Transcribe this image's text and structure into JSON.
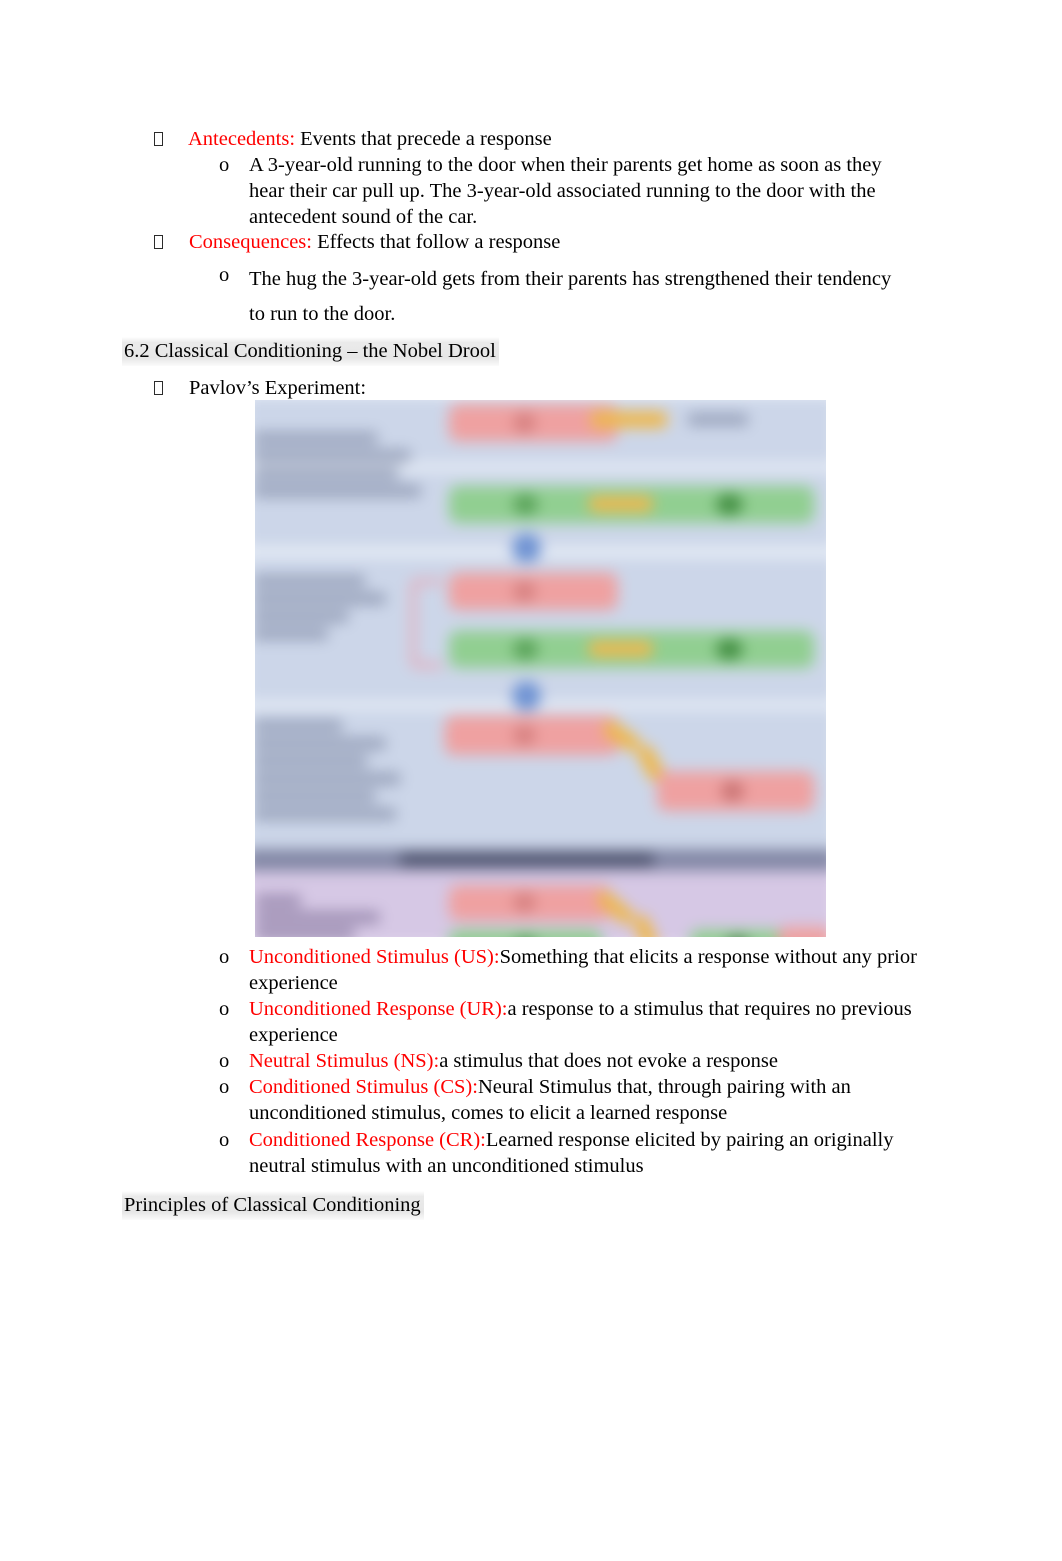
{
  "document": {
    "page_background": "#ffffff",
    "accent_red": "#ff0000",
    "body_color": "#000000"
  },
  "content": {
    "antecedents": {
      "bullet_glyph": "square-box-glyph",
      "term": "Antecedents:",
      "definition": " Events that precede a response",
      "sub_bullet_marker": "o",
      "sub_lines": [
        "A 3-year-old running to the door when their parents get home as soon as they",
        "hear their car pull up. The 3-year-old associated running to the door with the",
        "antecedent sound of the car."
      ]
    },
    "consequences": {
      "bullet_glyph": "square-box-glyph",
      "term": "Consequences:",
      "definition": " Effects that follow a response",
      "sub_bullet_marker": "o",
      "sub_lines": [
        "The hug the 3-year-old gets from their parents has strengthened their tendency",
        "to run to the door."
      ]
    },
    "section_heading": "6.2 Classical Conditioning – the Nobel Drool",
    "pavlov": {
      "bullet_glyph": "square-box-glyph",
      "label": "Pavlov’s Experiment:"
    },
    "figure": {
      "name": "pavlov-classical-conditioning-diagram",
      "description": "Blurred four-panel diagram of Pavlov's classical conditioning experiment",
      "panel_background_top": "#ccd6ea",
      "panel_background_bottom": "#d6c8e6",
      "divider_bar": "#7b7f9b",
      "stimulus_box_color": "#f2a0a0",
      "response_box_color": "#8fd08f",
      "arrow_color": "#f0b84a",
      "dot_color": "#6c92d6"
    },
    "definitions": [
      {
        "marker": "o",
        "term": "Unconditioned Stimulus (US):",
        "text": "Something that elicits a response without any prior",
        "continuation": [
          "experience"
        ]
      },
      {
        "marker": "o",
        "term": "Unconditioned Response (UR):",
        "text": "a response to a stimulus that requires no previous",
        "continuation": [
          "experience"
        ]
      },
      {
        "marker": "o",
        "term": "Neutral Stimulus (NS):",
        "text": "a stimulus that does not evoke a response",
        "continuation": []
      },
      {
        "marker": "o",
        "term": "Conditioned Stimulus (CS):",
        "text": "Neural Stimulus that, through pairing with an",
        "continuation": [
          "unconditioned stimulus, comes to elicit a learned response"
        ]
      },
      {
        "marker": "o",
        "term": "Conditioned Response (CR):",
        "text": "Learned response elicited by pairing an originally",
        "continuation": [
          "neutral stimulus with an unconditioned stimulus"
        ]
      }
    ],
    "closing_heading": "Principles of Classical Conditioning"
  }
}
